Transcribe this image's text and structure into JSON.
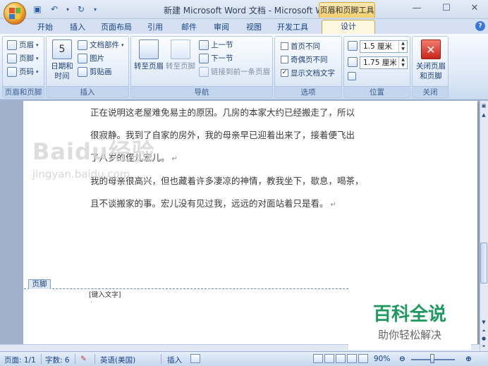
{
  "window": {
    "title": "新建 Microsoft Word 文档 - Microsoft Word",
    "context_tab_title": "页眉和页脚工具",
    "controls": [
      "—",
      "☐",
      "✕"
    ]
  },
  "quick_access": {
    "save_icon": "save-icon",
    "undo_icon": "undo-icon",
    "redo_icon": "redo-icon"
  },
  "tabs": [
    "开始",
    "插入",
    "页面布局",
    "引用",
    "邮件",
    "审阅",
    "视图",
    "开发工具",
    "设计"
  ],
  "active_tab": "设计",
  "ribbon": {
    "header_footer": {
      "label": "页眉和页脚",
      "items": [
        "页眉",
        "页脚",
        "页码"
      ]
    },
    "insert": {
      "label": "插入",
      "date_time": "日期和\n时间",
      "date_time_a": "日期和",
      "date_time_b": "时间",
      "calendar_num": "5",
      "items": [
        "文档部件",
        "图片",
        "剪贴画"
      ]
    },
    "navigation": {
      "label": "导航",
      "goto_header": "转至页眉",
      "goto_footer": "转至页脚",
      "prev": "上一节",
      "next": "下一节",
      "link_prev": "链接到前一条页眉"
    },
    "options": {
      "label": "选项",
      "items": [
        {
          "label": "首页不同",
          "checked": false
        },
        {
          "label": "奇偶页不同",
          "checked": false
        },
        {
          "label": "显示文档文字",
          "checked": true
        }
      ]
    },
    "position": {
      "label": "位置",
      "header_value": "1.5 厘米",
      "footer_value": "1.75 厘米"
    },
    "close": {
      "label": "关闭",
      "button_a": "关闭页眉",
      "button_b": "和页脚"
    }
  },
  "document": {
    "lines": [
      "正在说明这老屋难免易主的原因。几房的本家大约已经搬走了，所以",
      "很寂静。我到了自家的房外，我的母亲早已迎着出来了，接着便飞出",
      "了八岁的侄儿宏儿。",
      "我的母亲很高兴，但也藏着许多凄凉的神情，教我坐下，歇息，喝茶，",
      "且不谈搬家的事。宏儿没有见过我，远远的对面站着只是看。"
    ],
    "para_mark": "↵",
    "footer_tag": "页脚",
    "footer_placeholder": "[键入文字]"
  },
  "watermark": {
    "brand": "Baidu经验",
    "url": "jingyan.baidu.com"
  },
  "branding": {
    "main": "百科全说",
    "sub": "助你轻松解决"
  },
  "status": {
    "page": "页面: 1/1",
    "words": "字数: 6",
    "language": "英语(美国)",
    "mode": "插入",
    "zoom": "90%"
  }
}
